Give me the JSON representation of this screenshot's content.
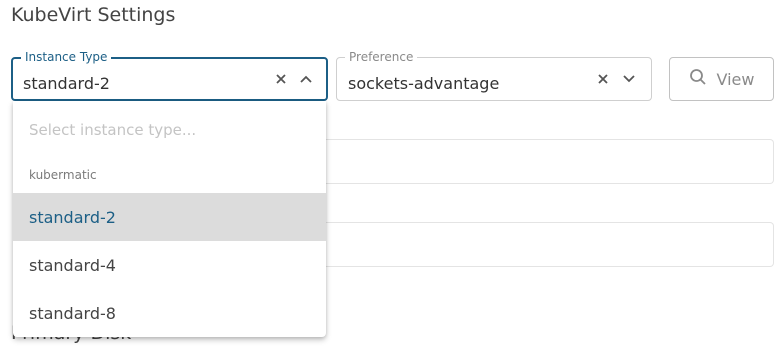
{
  "section_title": "KubeVirt Settings",
  "bottom_heading": "Primary Disk",
  "instance_type": {
    "label": "Instance Type",
    "value": "standard-2"
  },
  "preference": {
    "label": "Preference",
    "value": "sockets-advantage"
  },
  "view_button": {
    "label": "View"
  },
  "dropdown": {
    "search_placeholder": "Select instance type...",
    "group_label": "kubermatic",
    "options": [
      {
        "label": "standard-2",
        "selected": true
      },
      {
        "label": "standard-4",
        "selected": false
      },
      {
        "label": "standard-8",
        "selected": false
      }
    ]
  },
  "colors": {
    "accent": "#1c5f86",
    "selected_bg": "#dcdcdc"
  },
  "icons": {
    "clear": "close-icon",
    "chevron": "chevron-up-icon",
    "chevron_closed": "chevron-down-icon",
    "view": "search-icon"
  }
}
